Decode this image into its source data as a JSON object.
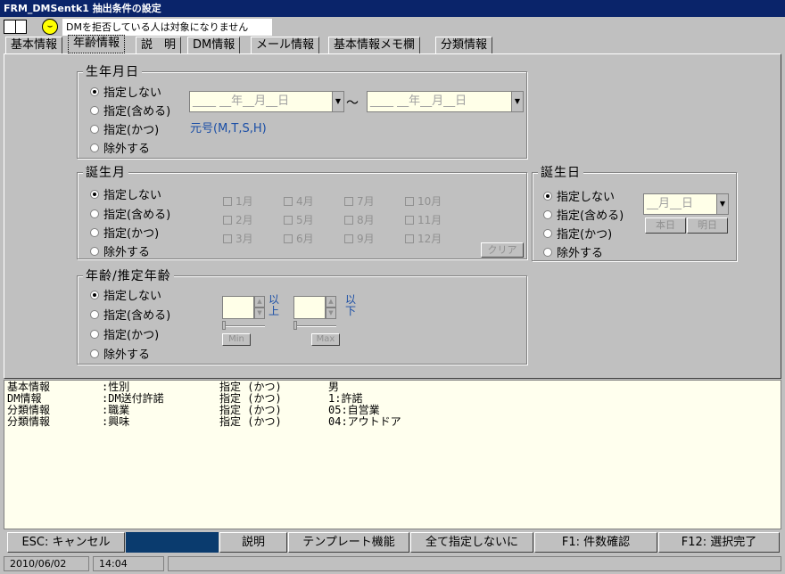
{
  "window": {
    "title": "FRM_DMSentk1 抽出条件の設定"
  },
  "notice": "DMを拒否している人は対象になりません",
  "tabs": [
    "基本情報",
    "年齢情報",
    "説　明",
    "DM情報",
    "メール情報",
    "基本情報メモ欄",
    "分類情報"
  ],
  "active_tab": "年齢情報",
  "radio_options": [
    "指定しない",
    "指定(含める)",
    "指定(かつ)",
    "除外する"
  ],
  "birth_date": {
    "legend": "生年月日",
    "from_placeholder": "____ __年__月__日",
    "to_placeholder": "____ __年__月__日",
    "tilde": "～",
    "era_note": "元号(M,T,S,H)"
  },
  "birth_month": {
    "legend": "誕生月",
    "months": [
      "1月",
      "4月",
      "7月",
      "10月",
      "2月",
      "5月",
      "8月",
      "11月",
      "3月",
      "6月",
      "9月",
      "12月"
    ],
    "clear_label": "クリア"
  },
  "birthday": {
    "legend": "誕生日",
    "radio_options": [
      "指定しない",
      "指定(含める)",
      "指定(かつ)",
      "除外する"
    ],
    "placeholder": "__月__日",
    "today_label": "本日",
    "tomorrow_label": "明日"
  },
  "age": {
    "legend": "年齢/推定年齢",
    "min_suffix": [
      "以",
      "上"
    ],
    "max_suffix": [
      "以",
      "下"
    ],
    "min_label": "Min",
    "max_label": "Max"
  },
  "summary_rows": [
    [
      "基本情報",
      ":性別",
      "指定 (かつ)",
      "男"
    ],
    [
      "DM情報",
      ":DM送付許諾",
      "指定 (かつ)",
      "1:許諾"
    ],
    [
      "分類情報",
      ":職業",
      "指定 (かつ)",
      "05:自営業"
    ],
    [
      "分類情報",
      ":興味",
      "指定 (かつ)",
      "04:アウトドア"
    ]
  ],
  "function_keys": {
    "esc": "ESC: キャンセル",
    "explain": "説明",
    "template": "テンプレート機能",
    "all_none": "全て指定しないに",
    "f1": "F1: 件数確認",
    "f12": "F12: 選択完了"
  },
  "status": {
    "date": "2010/06/02",
    "time": "14:04"
  },
  "colors": {
    "titlebar": "#0a246a",
    "field_bg": "#ffffe8",
    "summary_bg": "#ffffee",
    "accent_text": "#1a4ea6"
  }
}
